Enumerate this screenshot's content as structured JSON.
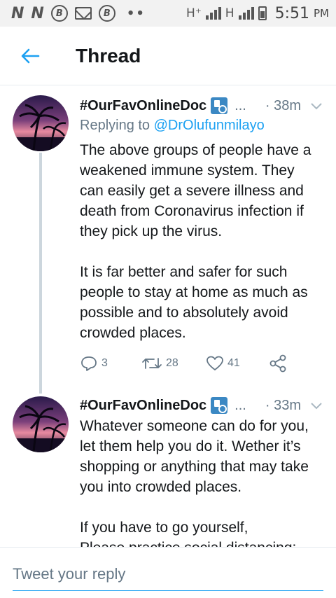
{
  "status_bar": {
    "left_icons": [
      "N",
      "N",
      "B",
      "mail",
      "B"
    ],
    "dots": "••",
    "network1": "H⁺",
    "network2": "H",
    "time": "5:51",
    "ampm": "PM"
  },
  "header": {
    "title": "Thread",
    "back_icon": "arrow-left-icon"
  },
  "colors": {
    "accent": "#1da1f2",
    "secondary_text": "#657786",
    "primary_text": "#14171a",
    "thread_line": "#ccd6dd"
  },
  "tweets": [
    {
      "author": "#OurFavOnlineDoc",
      "badge_icon": "hospital-emoji-icon",
      "ellipsis": "...",
      "time": "· 38m",
      "replying_label": "Replying to",
      "replying_handle": "@DrOlufunmilayo",
      "paragraphs": [
        "The above groups of people have a weakened immune system. They can easily get a severe illness and death from Coronavirus infection if they pick up the virus.",
        "It is far better and safer for such people to stay at home as much as possible and to absolutely avoid crowded places."
      ],
      "replies": "3",
      "retweets": "28",
      "likes": "41"
    },
    {
      "author": "#OurFavOnlineDoc",
      "badge_icon": "hospital-emoji-icon",
      "ellipsis": "...",
      "time": "· 33m",
      "paragraphs": [
        "Whatever someone can do for you, let them help you do it. Wether it’s shopping or anything that may take you into crowded places.",
        "If you have to go yourself,",
        "Please practice social distancing:"
      ]
    }
  ],
  "reply_bar": {
    "placeholder": "Tweet your reply"
  }
}
